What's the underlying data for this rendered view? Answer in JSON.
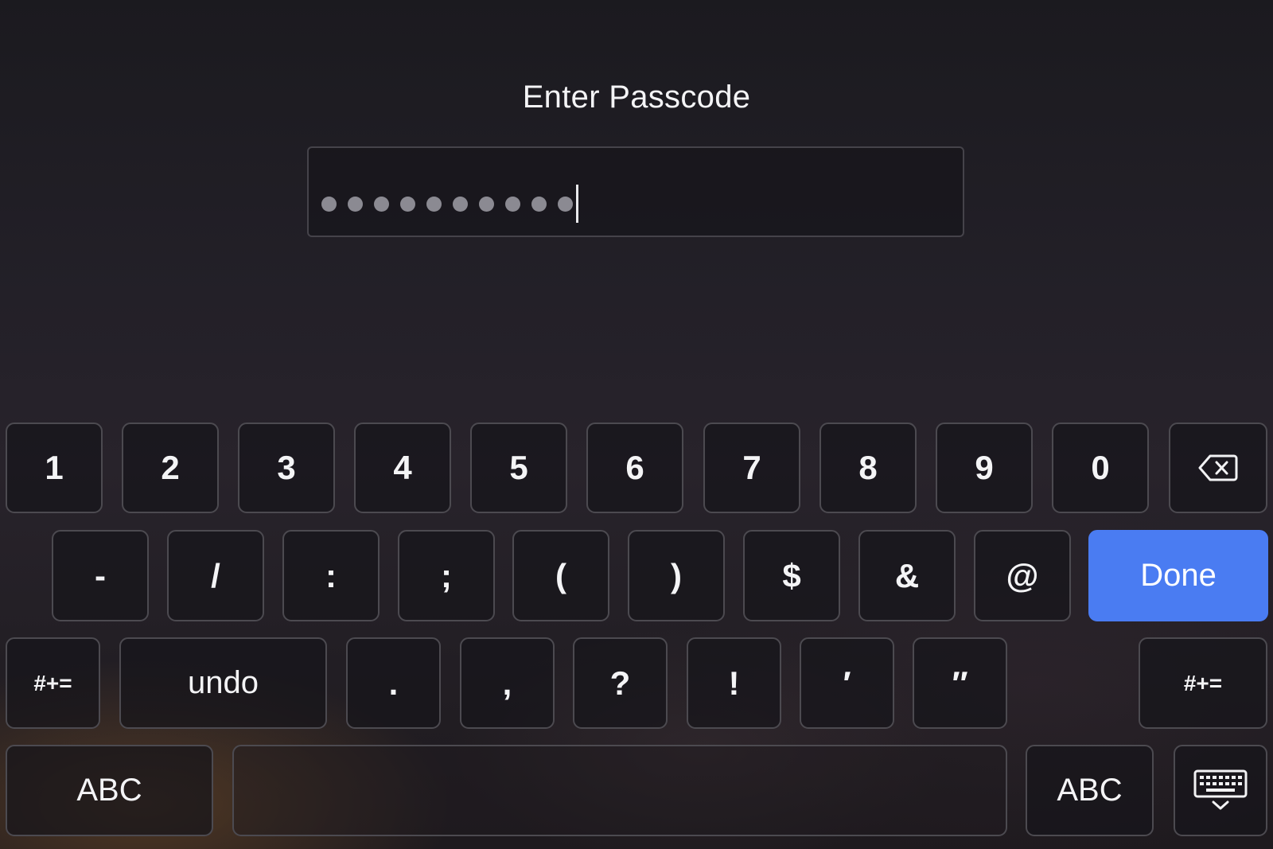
{
  "prompt": {
    "title": "Enter Passcode"
  },
  "passcode_field": {
    "masked_character_count": 10,
    "has_cursor": true
  },
  "keyboard": {
    "row1": [
      "1",
      "2",
      "3",
      "4",
      "5",
      "6",
      "7",
      "8",
      "9",
      "0"
    ],
    "delete_key_icon": "backspace-icon",
    "row2": [
      "-",
      "/",
      ":",
      ";",
      "(",
      ")",
      "$",
      "&",
      "@"
    ],
    "done_label": "Done",
    "row3_left_shift": "#+=",
    "undo_label": "undo",
    "row3": [
      ".",
      ",",
      "?",
      "!",
      "′",
      "″"
    ],
    "row3_right_shift": "#+=",
    "abc_left": "ABC",
    "abc_right": "ABC",
    "dismiss_key_icon": "keyboard-dismiss-icon",
    "colors": {
      "done_background": "#4a7cf2",
      "key_border": "#4c4a50"
    }
  }
}
